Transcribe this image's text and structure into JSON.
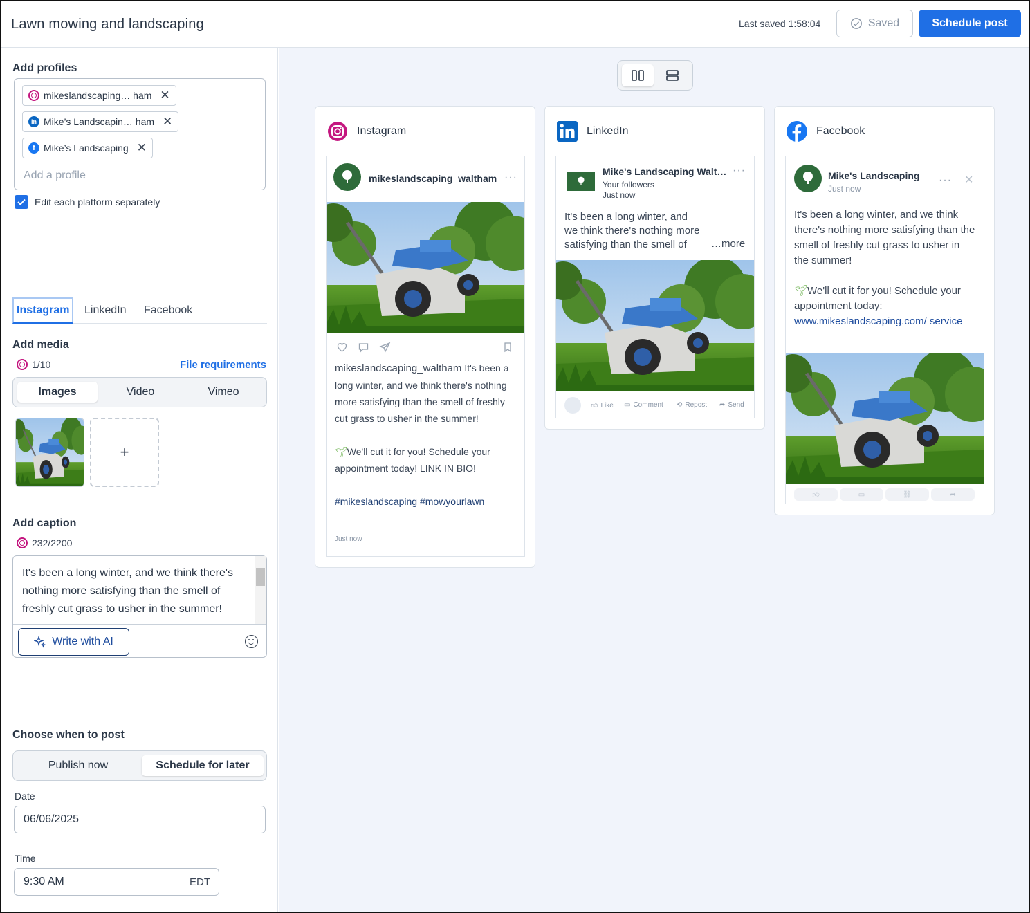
{
  "header": {
    "title": "Lawn mowing and landscaping",
    "last_saved": "Last saved 1:58:04",
    "saved_label": "Saved",
    "schedule_label": "Schedule post"
  },
  "profiles": {
    "heading": "Add profiles",
    "chips": [
      {
        "name": "mikeslandscaping… ham",
        "platform": "instagram"
      },
      {
        "name": "Mike’s Landscapin… ham",
        "platform": "linkedin"
      },
      {
        "name": "Mike’s Landscaping",
        "platform": "facebook"
      }
    ],
    "placeholder": "Add a profile",
    "edit_separately": "Edit each platform separately"
  },
  "tabs": [
    "Instagram",
    "LinkedIn",
    "Facebook"
  ],
  "media": {
    "heading": "Add media",
    "count": "1/10",
    "file_requirements": "File requirements",
    "types": [
      "Images",
      "Video",
      "Vimeo"
    ],
    "add_symbol": "+"
  },
  "caption": {
    "heading": "Add caption",
    "count": "232/2200",
    "text": "It's been a long winter, and we think there's nothing more satisfying than the smell of freshly cut grass to usher in the summer!",
    "ai_label": "Write with AI"
  },
  "schedule": {
    "heading": "Choose when to post",
    "options": [
      "Publish now",
      "Schedule for later"
    ],
    "date_label": "Date",
    "date_value": "06/06/2025",
    "time_label": "Time",
    "time_value": "9:30 AM",
    "timezone": "EDT"
  },
  "previews": {
    "instagram": {
      "platform": "Instagram",
      "username": "mikeslandscaping_waltham",
      "caption_start": "It's been a long winter, and we think there's nothing more satisfying than the smell of freshly cut grass to usher in the summer!",
      "caption_cta": "We'll cut it for you! Schedule your appointment today! LINK IN BIO!",
      "hashtags": "#mikeslandscaping #mowyourlawn",
      "time": "Just now"
    },
    "linkedin": {
      "platform": "LinkedIn",
      "name": "Mike's Landscaping Walt…",
      "audience": "Your followers",
      "time": "Just now",
      "text": "It's been a long winter, and we think there's nothing more satisfying than the smell of",
      "more": "…more",
      "actions": [
        "Like",
        "Comment",
        "Repost",
        "Send"
      ]
    },
    "facebook": {
      "platform": "Facebook",
      "name": "Mike's Landscaping",
      "time": "Just now",
      "text": "It's been a long winter, and we think there's nothing more satisfying than the smell of freshly cut grass to usher in the summer!",
      "cta": "We'll cut it for you! Schedule your appointment today:",
      "link": "www.mikeslandscaping.com/ service"
    }
  },
  "colors": {
    "primary": "#1f6fe5",
    "instagram": "#c4167f",
    "linkedin": "#0a66c2",
    "facebook": "#1877f2",
    "canvas": "#f1f4fb"
  }
}
